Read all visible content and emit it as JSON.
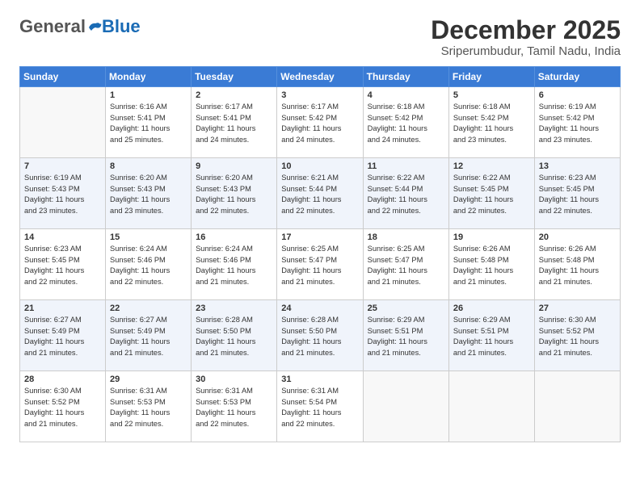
{
  "logo": {
    "general": "General",
    "blue": "Blue"
  },
  "title": "December 2025",
  "location": "Sriperumbudur, Tamil Nadu, India",
  "days_of_week": [
    "Sunday",
    "Monday",
    "Tuesday",
    "Wednesday",
    "Thursday",
    "Friday",
    "Saturday"
  ],
  "weeks": [
    [
      {
        "day": "",
        "info": ""
      },
      {
        "day": "1",
        "info": "Sunrise: 6:16 AM\nSunset: 5:41 PM\nDaylight: 11 hours\nand 25 minutes."
      },
      {
        "day": "2",
        "info": "Sunrise: 6:17 AM\nSunset: 5:41 PM\nDaylight: 11 hours\nand 24 minutes."
      },
      {
        "day": "3",
        "info": "Sunrise: 6:17 AM\nSunset: 5:42 PM\nDaylight: 11 hours\nand 24 minutes."
      },
      {
        "day": "4",
        "info": "Sunrise: 6:18 AM\nSunset: 5:42 PM\nDaylight: 11 hours\nand 24 minutes."
      },
      {
        "day": "5",
        "info": "Sunrise: 6:18 AM\nSunset: 5:42 PM\nDaylight: 11 hours\nand 23 minutes."
      },
      {
        "day": "6",
        "info": "Sunrise: 6:19 AM\nSunset: 5:42 PM\nDaylight: 11 hours\nand 23 minutes."
      }
    ],
    [
      {
        "day": "7",
        "info": "Sunrise: 6:19 AM\nSunset: 5:43 PM\nDaylight: 11 hours\nand 23 minutes."
      },
      {
        "day": "8",
        "info": "Sunrise: 6:20 AM\nSunset: 5:43 PM\nDaylight: 11 hours\nand 23 minutes."
      },
      {
        "day": "9",
        "info": "Sunrise: 6:20 AM\nSunset: 5:43 PM\nDaylight: 11 hours\nand 22 minutes."
      },
      {
        "day": "10",
        "info": "Sunrise: 6:21 AM\nSunset: 5:44 PM\nDaylight: 11 hours\nand 22 minutes."
      },
      {
        "day": "11",
        "info": "Sunrise: 6:22 AM\nSunset: 5:44 PM\nDaylight: 11 hours\nand 22 minutes."
      },
      {
        "day": "12",
        "info": "Sunrise: 6:22 AM\nSunset: 5:45 PM\nDaylight: 11 hours\nand 22 minutes."
      },
      {
        "day": "13",
        "info": "Sunrise: 6:23 AM\nSunset: 5:45 PM\nDaylight: 11 hours\nand 22 minutes."
      }
    ],
    [
      {
        "day": "14",
        "info": "Sunrise: 6:23 AM\nSunset: 5:45 PM\nDaylight: 11 hours\nand 22 minutes."
      },
      {
        "day": "15",
        "info": "Sunrise: 6:24 AM\nSunset: 5:46 PM\nDaylight: 11 hours\nand 22 minutes."
      },
      {
        "day": "16",
        "info": "Sunrise: 6:24 AM\nSunset: 5:46 PM\nDaylight: 11 hours\nand 21 minutes."
      },
      {
        "day": "17",
        "info": "Sunrise: 6:25 AM\nSunset: 5:47 PM\nDaylight: 11 hours\nand 21 minutes."
      },
      {
        "day": "18",
        "info": "Sunrise: 6:25 AM\nSunset: 5:47 PM\nDaylight: 11 hours\nand 21 minutes."
      },
      {
        "day": "19",
        "info": "Sunrise: 6:26 AM\nSunset: 5:48 PM\nDaylight: 11 hours\nand 21 minutes."
      },
      {
        "day": "20",
        "info": "Sunrise: 6:26 AM\nSunset: 5:48 PM\nDaylight: 11 hours\nand 21 minutes."
      }
    ],
    [
      {
        "day": "21",
        "info": "Sunrise: 6:27 AM\nSunset: 5:49 PM\nDaylight: 11 hours\nand 21 minutes."
      },
      {
        "day": "22",
        "info": "Sunrise: 6:27 AM\nSunset: 5:49 PM\nDaylight: 11 hours\nand 21 minutes."
      },
      {
        "day": "23",
        "info": "Sunrise: 6:28 AM\nSunset: 5:50 PM\nDaylight: 11 hours\nand 21 minutes."
      },
      {
        "day": "24",
        "info": "Sunrise: 6:28 AM\nSunset: 5:50 PM\nDaylight: 11 hours\nand 21 minutes."
      },
      {
        "day": "25",
        "info": "Sunrise: 6:29 AM\nSunset: 5:51 PM\nDaylight: 11 hours\nand 21 minutes."
      },
      {
        "day": "26",
        "info": "Sunrise: 6:29 AM\nSunset: 5:51 PM\nDaylight: 11 hours\nand 21 minutes."
      },
      {
        "day": "27",
        "info": "Sunrise: 6:30 AM\nSunset: 5:52 PM\nDaylight: 11 hours\nand 21 minutes."
      }
    ],
    [
      {
        "day": "28",
        "info": "Sunrise: 6:30 AM\nSunset: 5:52 PM\nDaylight: 11 hours\nand 21 minutes."
      },
      {
        "day": "29",
        "info": "Sunrise: 6:31 AM\nSunset: 5:53 PM\nDaylight: 11 hours\nand 22 minutes."
      },
      {
        "day": "30",
        "info": "Sunrise: 6:31 AM\nSunset: 5:53 PM\nDaylight: 11 hours\nand 22 minutes."
      },
      {
        "day": "31",
        "info": "Sunrise: 6:31 AM\nSunset: 5:54 PM\nDaylight: 11 hours\nand 22 minutes."
      },
      {
        "day": "",
        "info": ""
      },
      {
        "day": "",
        "info": ""
      },
      {
        "day": "",
        "info": ""
      }
    ]
  ]
}
